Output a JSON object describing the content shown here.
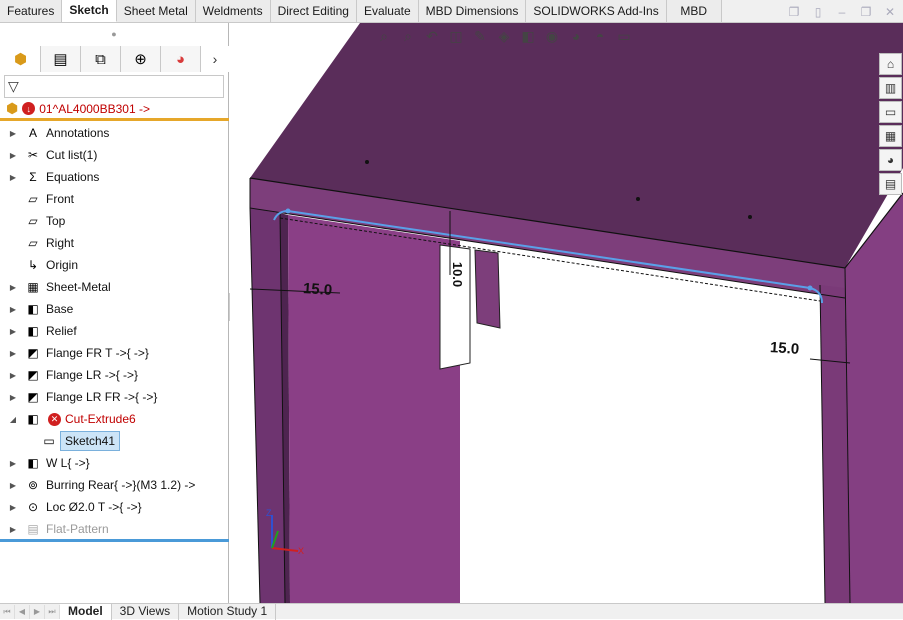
{
  "command_tabs": [
    "Features",
    "Sketch",
    "Sheet Metal",
    "Weldments",
    "Direct Editing",
    "Evaluate",
    "MBD Dimensions",
    "SOLIDWORKS Add-Ins",
    "MBD"
  ],
  "active_tab": "Sketch",
  "part": {
    "name": "01^AL4000BB301 ->"
  },
  "tree": [
    {
      "label": "Annotations",
      "icon": "annotations-icon",
      "glyph": "A",
      "expand": true
    },
    {
      "label": "Cut list(1)",
      "icon": "cut-list-icon",
      "glyph": "✂",
      "expand": true
    },
    {
      "label": "Equations",
      "icon": "equations-icon",
      "glyph": "Σ",
      "expand": true
    },
    {
      "label": "Front",
      "icon": "plane-icon",
      "glyph": "▱",
      "expand": false
    },
    {
      "label": "Top",
      "icon": "plane-icon",
      "glyph": "▱",
      "expand": false
    },
    {
      "label": "Right",
      "icon": "plane-icon",
      "glyph": "▱",
      "expand": false
    },
    {
      "label": "Origin",
      "icon": "origin-icon",
      "glyph": "↳",
      "expand": false
    },
    {
      "label": "Sheet-Metal",
      "icon": "sheet-metal-icon",
      "glyph": "▦",
      "expand": true
    },
    {
      "label": "Base",
      "icon": "base-flange-icon",
      "glyph": "◧",
      "expand": true
    },
    {
      "label": "Relief",
      "icon": "relief-icon",
      "glyph": "◧",
      "expand": true
    },
    {
      "label": "Flange FR T ->{ ->}",
      "icon": "edge-flange-icon",
      "glyph": "◩",
      "expand": true
    },
    {
      "label": "Flange LR ->{ ->}",
      "icon": "edge-flange-icon",
      "glyph": "◩",
      "expand": true
    },
    {
      "label": "Flange LR FR ->{ ->}",
      "icon": "edge-flange-icon",
      "glyph": "◩",
      "expand": true
    },
    {
      "label": "Cut-Extrude6",
      "icon": "cut-extrude-icon",
      "glyph": "◧",
      "expand": true,
      "expanded": true,
      "error": true
    },
    {
      "label": "Sketch41",
      "icon": "sketch-icon",
      "glyph": "▭",
      "child": true,
      "selected": true
    },
    {
      "label": "W L{ ->}",
      "icon": "weld-icon",
      "glyph": "◧",
      "expand": true
    },
    {
      "label": "Burring Rear{ ->}(M3 1.2) ->",
      "icon": "burring-icon",
      "glyph": "⊚",
      "expand": true
    },
    {
      "label": "Loc Ø2.0 T ->{ ->}",
      "icon": "hole-icon",
      "glyph": "⊙",
      "expand": true
    },
    {
      "label": "Flat-Pattern",
      "icon": "flat-pattern-icon",
      "glyph": "▤",
      "expand": true,
      "suppressed": true
    }
  ],
  "bottom_tabs": [
    "Model",
    "3D Views",
    "Motion Study 1"
  ],
  "active_bottom_tab": "Model",
  "dimensions": {
    "d1": "15.0",
    "d2": "15.0",
    "d3": "10.0"
  },
  "colors": {
    "part_purple": "#8a3f86",
    "sketch_blue": "#5aa0e8",
    "part_error_red": "#c00000",
    "rollback_bar": "#e6a72a"
  }
}
